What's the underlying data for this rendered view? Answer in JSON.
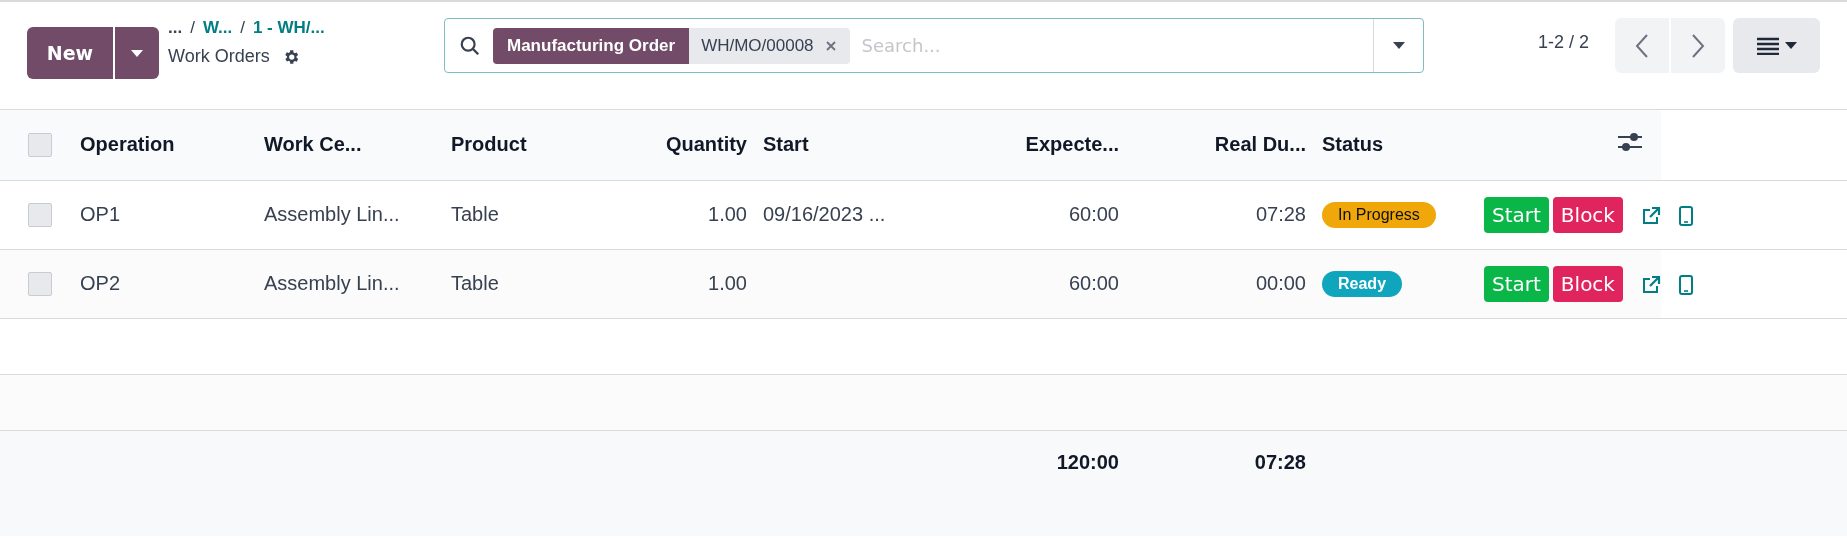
{
  "control_panel": {
    "new_button": "New",
    "breadcrumbs": [
      {
        "label": "...",
        "separator": "/"
      },
      {
        "label": "W...",
        "separator": "/"
      },
      {
        "label": "1 - WH/..."
      }
    ],
    "title": "Work Orders",
    "search": {
      "facet": {
        "label": "Manufacturing Order",
        "value": "WH/MO/00008"
      },
      "placeholder": "Search..."
    },
    "pager": "1-2 / 2"
  },
  "table": {
    "select_all": {
      "checked": false
    },
    "columns": [
      {
        "label": "Operation",
        "kind": "text"
      },
      {
        "label": "Work Ce...",
        "kind": "text"
      },
      {
        "label": "Product",
        "kind": "text"
      },
      {
        "label": "Quantity",
        "kind": "number"
      },
      {
        "label": "Start",
        "kind": "text"
      },
      {
        "label": "Expecte...",
        "kind": "number"
      },
      {
        "label": "Real Du...",
        "kind": "number"
      },
      {
        "label": "Status",
        "kind": "text"
      }
    ],
    "rows": [
      {
        "checked": false,
        "operation": "OP1",
        "work_center": "Assembly Lin...",
        "product": "Table",
        "quantity": "1.00",
        "start": "09/16/2023 ...",
        "expected": "60:00",
        "real_duration": "07:28",
        "status": {
          "label": "In Progress",
          "color": "#f0a70a"
        },
        "actions": [
          "Start",
          "Block"
        ]
      },
      {
        "checked": false,
        "operation": "OP2",
        "work_center": "Assembly Lin...",
        "product": "Table",
        "quantity": "1.00",
        "start": "",
        "expected": "60:00",
        "real_duration": "00:00",
        "status": {
          "label": "Ready",
          "color": "#0fa5bd"
        },
        "actions": [
          "Start",
          "Block"
        ]
      }
    ],
    "totals": {
      "expected": "120:00",
      "real_duration": "07:28"
    }
  }
}
